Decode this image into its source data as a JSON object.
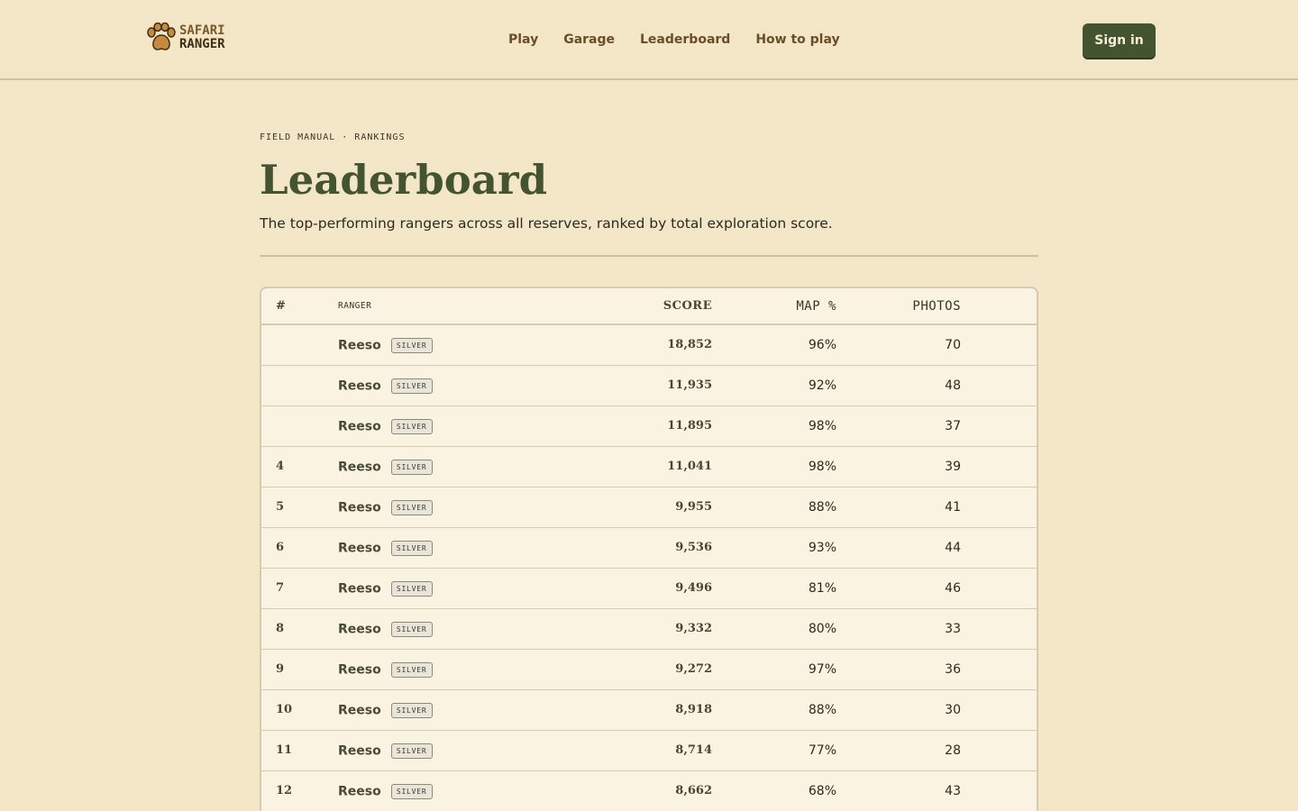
{
  "header": {
    "logo_line1": "SAFARI",
    "logo_line2": "RANGER",
    "nav": [
      "Play",
      "Garage",
      "Leaderboard",
      "How to play"
    ],
    "signin_label": "Sign in"
  },
  "page": {
    "eyebrow": "FIELD MANUAL · RANKINGS",
    "title": "Leaderboard",
    "subtitle": "The top-performing rangers across all reserves, ranked by total exploration score."
  },
  "table": {
    "columns": [
      "#",
      "RANGER",
      "SCORE",
      "MAP %",
      "PHOTOS"
    ],
    "rows": [
      {
        "rank": "",
        "name": "Reeso",
        "badge": "SILVER",
        "score": "18,852",
        "map": "96%",
        "photos": "70"
      },
      {
        "rank": "",
        "name": "Reeso",
        "badge": "SILVER",
        "score": "11,935",
        "map": "92%",
        "photos": "48"
      },
      {
        "rank": "",
        "name": "Reeso",
        "badge": "SILVER",
        "score": "11,895",
        "map": "98%",
        "photos": "37"
      },
      {
        "rank": "4",
        "name": "Reeso",
        "badge": "SILVER",
        "score": "11,041",
        "map": "98%",
        "photos": "39"
      },
      {
        "rank": "5",
        "name": "Reeso",
        "badge": "SILVER",
        "score": "9,955",
        "map": "88%",
        "photos": "41"
      },
      {
        "rank": "6",
        "name": "Reeso",
        "badge": "SILVER",
        "score": "9,536",
        "map": "93%",
        "photos": "44"
      },
      {
        "rank": "7",
        "name": "Reeso",
        "badge": "SILVER",
        "score": "9,496",
        "map": "81%",
        "photos": "46"
      },
      {
        "rank": "8",
        "name": "Reeso",
        "badge": "SILVER",
        "score": "9,332",
        "map": "80%",
        "photos": "33"
      },
      {
        "rank": "9",
        "name": "Reeso",
        "badge": "SILVER",
        "score": "9,272",
        "map": "97%",
        "photos": "36"
      },
      {
        "rank": "10",
        "name": "Reeso",
        "badge": "SILVER",
        "score": "8,918",
        "map": "88%",
        "photos": "30"
      },
      {
        "rank": "11",
        "name": "Reeso",
        "badge": "SILVER",
        "score": "8,714",
        "map": "77%",
        "photos": "28"
      },
      {
        "rank": "12",
        "name": "Reeso",
        "badge": "SILVER",
        "score": "8,662",
        "map": "68%",
        "photos": "43"
      }
    ]
  }
}
